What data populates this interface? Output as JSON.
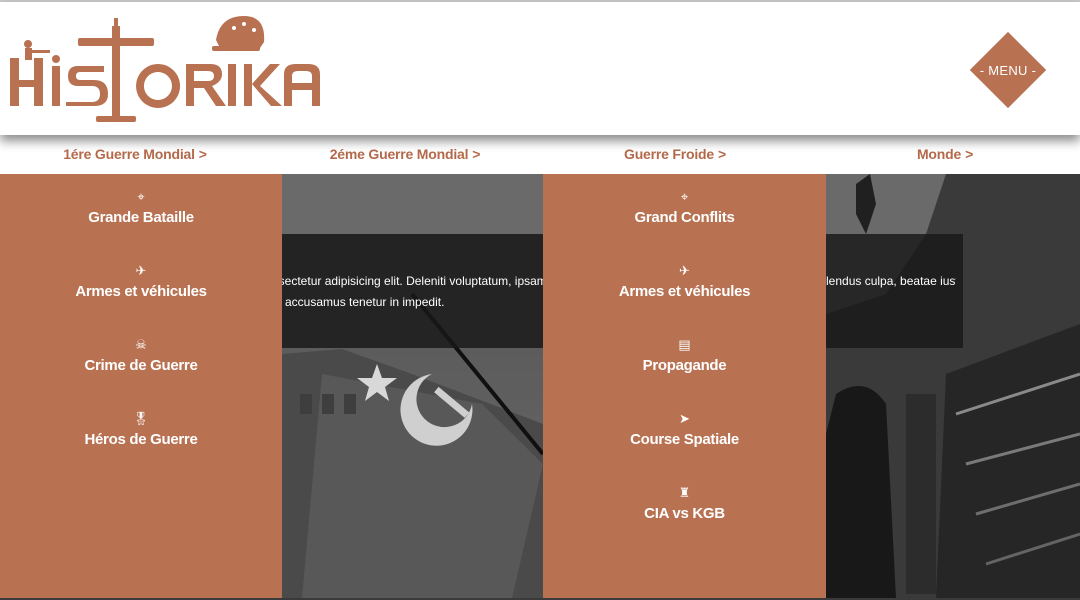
{
  "header": {
    "logo_text": "HISTORIKA",
    "menu_label": "- MENU -"
  },
  "nav": {
    "items": [
      {
        "label": "1ére Guerre Mondial",
        "chevron": ">"
      },
      {
        "label": "2éme Guerre Mondial",
        "chevron": ">"
      },
      {
        "label": "Guerre Froide",
        "chevron": ">"
      },
      {
        "label": "Monde",
        "chevron": ">"
      }
    ]
  },
  "submenu_left": {
    "items": [
      {
        "icon": "binoculars-icon",
        "glyph": "⌖",
        "label": "Grande Bataille"
      },
      {
        "icon": "plane-icon",
        "glyph": "✈",
        "label": "Armes et véhicules"
      },
      {
        "icon": "skull-icon",
        "glyph": "☠",
        "label": "Crime de Guerre"
      },
      {
        "icon": "medal-icon",
        "glyph": "🎖",
        "label": "Héros de Guerre"
      }
    ]
  },
  "submenu_right": {
    "items": [
      {
        "icon": "binoculars-icon",
        "glyph": "⌖",
        "label": "Grand Conflits"
      },
      {
        "icon": "plane-icon",
        "glyph": "✈",
        "label": "Armes et véhicules"
      },
      {
        "icon": "newspaper-icon",
        "glyph": "▤",
        "label": "Propagande"
      },
      {
        "icon": "rocket-icon",
        "glyph": "➤",
        "label": "Course Spatiale"
      },
      {
        "icon": "spy-icon",
        "glyph": "♜",
        "label": "CIA vs KGB"
      }
    ]
  },
  "slides": {
    "mid_caption_line1": "nsectetur adipisicing elit. Deleniti voluptatum, ipsam tem",
    "mid_caption_line2": "accusamus tenetur in impedit.",
    "right_caption_line1": "lendus culpa, beatae iusto"
  },
  "colors": {
    "accent": "#b87151",
    "nav_text": "#b46a4a"
  }
}
